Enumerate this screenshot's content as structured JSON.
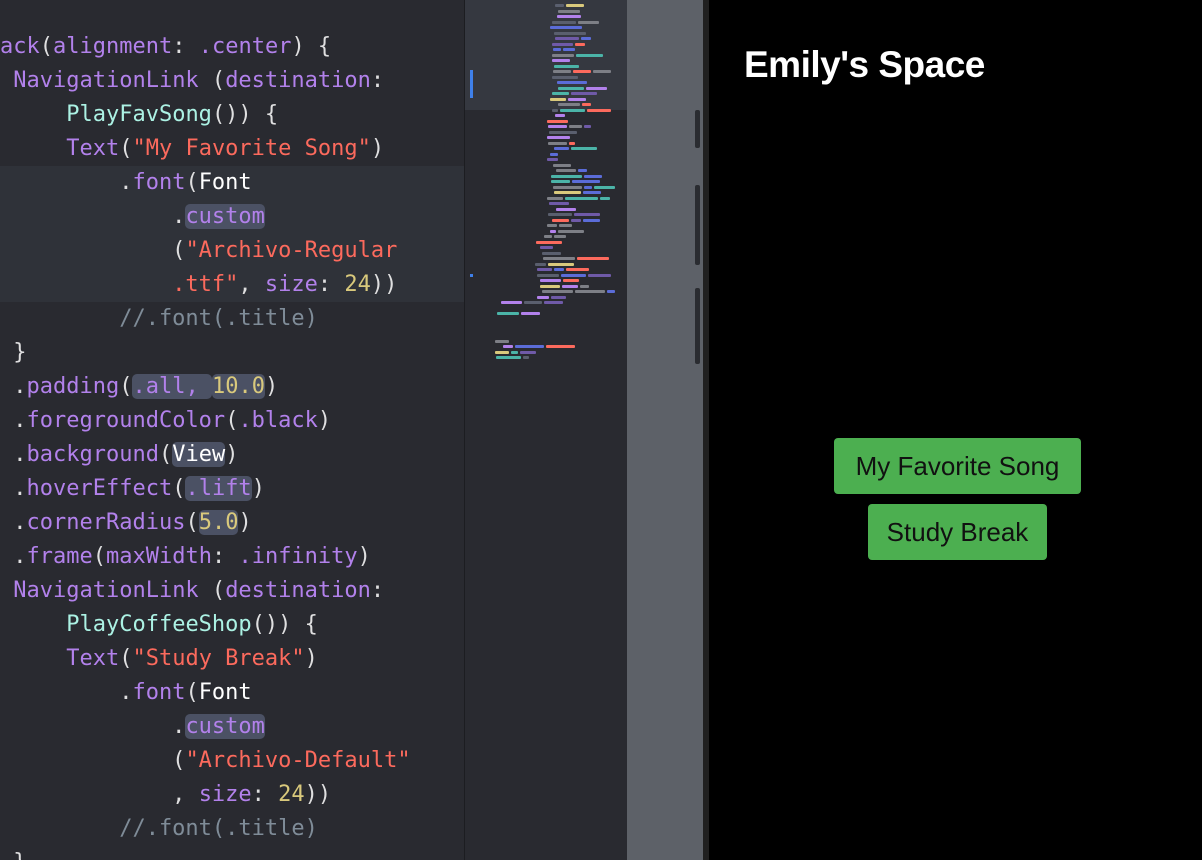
{
  "colors": {
    "editor_bg": "#292a30",
    "keyword": "#fc5fa3",
    "function": "#b281eb",
    "type": "#acf2e4",
    "string": "#fc6a5d",
    "number": "#d9c97c",
    "comment": "#7f8c98",
    "button_green": "#4caf50",
    "preview_bg": "#000000"
  },
  "code_lines": [
    {
      "tokens": [
        {
          "t": "ack",
          "c": "fn"
        },
        {
          "t": "(",
          "c": "pl"
        },
        {
          "t": "alignment",
          "c": "fn"
        },
        {
          "t": ": ",
          "c": "pl"
        },
        {
          "t": ".center",
          "c": "fn"
        },
        {
          "t": ") {",
          "c": "pl"
        }
      ]
    },
    {
      "tokens": [
        {
          "t": " ",
          "c": "pl"
        },
        {
          "t": "NavigationLink",
          "c": "fn"
        },
        {
          "t": " (",
          "c": "pl"
        },
        {
          "t": "destination",
          "c": "fn"
        },
        {
          "t": ":",
          "c": "pl"
        }
      ]
    },
    {
      "tokens": [
        {
          "t": "     ",
          "c": "pl"
        },
        {
          "t": "PlayFavSong",
          "c": "ty"
        },
        {
          "t": "()) {",
          "c": "pl"
        }
      ]
    },
    {
      "tokens": [
        {
          "t": "     ",
          "c": "pl"
        },
        {
          "t": "Text",
          "c": "fn"
        },
        {
          "t": "(",
          "c": "pl"
        },
        {
          "t": "\"My Favorite Song\"",
          "c": "st"
        },
        {
          "t": ")",
          "c": "pl"
        }
      ]
    },
    {
      "hl": true,
      "tokens": [
        {
          "t": "         .",
          "c": "pl"
        },
        {
          "t": "font",
          "c": "fn"
        },
        {
          "t": "(",
          "c": "pl"
        },
        {
          "t": "Font",
          "c": "k"
        }
      ]
    },
    {
      "hl": true,
      "tokens": [
        {
          "t": "             .",
          "c": "pl"
        },
        {
          "t": "custom",
          "c": "fn",
          "pill": true
        }
      ]
    },
    {
      "hl": true,
      "tokens": [
        {
          "t": "             (",
          "c": "pl"
        },
        {
          "t": "\"Archivo-Regular",
          "c": "st"
        }
      ]
    },
    {
      "hl": true,
      "tokens": [
        {
          "t": "             ",
          "c": "pl"
        },
        {
          "t": ".ttf\"",
          "c": "st"
        },
        {
          "t": ", ",
          "c": "pl"
        },
        {
          "t": "size",
          "c": "fn"
        },
        {
          "t": ": ",
          "c": "pl"
        },
        {
          "t": "24",
          "c": "nm"
        },
        {
          "t": "))",
          "c": "pl"
        }
      ]
    },
    {
      "tokens": [
        {
          "t": "         //.font(.title)",
          "c": "cm"
        }
      ]
    },
    {
      "tokens": [
        {
          "t": " }",
          "c": "pl"
        }
      ]
    },
    {
      "tokens": [
        {
          "t": " .",
          "c": "pl"
        },
        {
          "t": "padding",
          "c": "fn"
        },
        {
          "t": "(",
          "c": "pl"
        },
        {
          "t": ".all, ",
          "c": "fn",
          "pill": true
        },
        {
          "t": "10.0",
          "c": "nm",
          "pill": true
        },
        {
          "t": ")",
          "c": "pl"
        }
      ]
    },
    {
      "tokens": [
        {
          "t": " .",
          "c": "pl"
        },
        {
          "t": "foregroundColor",
          "c": "fn"
        },
        {
          "t": "(",
          "c": "pl"
        },
        {
          "t": ".black",
          "c": "fn"
        },
        {
          "t": ")",
          "c": "pl"
        }
      ]
    },
    {
      "tokens": [
        {
          "t": " .",
          "c": "pl"
        },
        {
          "t": "background",
          "c": "fn"
        },
        {
          "t": "(",
          "c": "pl"
        },
        {
          "t": "View",
          "c": "k",
          "pill": true
        },
        {
          "t": ")",
          "c": "pl"
        }
      ]
    },
    {
      "tokens": [
        {
          "t": " .",
          "c": "pl"
        },
        {
          "t": "hoverEffect",
          "c": "fn"
        },
        {
          "t": "(",
          "c": "pl"
        },
        {
          "t": ".lift",
          "c": "fn",
          "pill": true
        },
        {
          "t": ")",
          "c": "pl"
        }
      ]
    },
    {
      "tokens": [
        {
          "t": " .",
          "c": "pl"
        },
        {
          "t": "cornerRadius",
          "c": "fn"
        },
        {
          "t": "(",
          "c": "pl"
        },
        {
          "t": "5.0",
          "c": "nm",
          "pill": true
        },
        {
          "t": ")",
          "c": "pl"
        }
      ]
    },
    {
      "tokens": [
        {
          "t": " .",
          "c": "pl"
        },
        {
          "t": "frame",
          "c": "fn"
        },
        {
          "t": "(",
          "c": "pl"
        },
        {
          "t": "maxWidth",
          "c": "fn"
        },
        {
          "t": ": ",
          "c": "pl"
        },
        {
          "t": ".infinity",
          "c": "fn"
        },
        {
          "t": ")",
          "c": "pl"
        }
      ]
    },
    {
      "tokens": [
        {
          "t": " ",
          "c": "pl"
        },
        {
          "t": "NavigationLink",
          "c": "fn"
        },
        {
          "t": " (",
          "c": "pl"
        },
        {
          "t": "destination",
          "c": "fn"
        },
        {
          "t": ":",
          "c": "pl"
        }
      ]
    },
    {
      "tokens": [
        {
          "t": "     ",
          "c": "pl"
        },
        {
          "t": "PlayCoffeeShop",
          "c": "ty"
        },
        {
          "t": "()) {",
          "c": "pl"
        }
      ]
    },
    {
      "tokens": [
        {
          "t": "     ",
          "c": "pl"
        },
        {
          "t": "Text",
          "c": "fn"
        },
        {
          "t": "(",
          "c": "pl"
        },
        {
          "t": "\"Study Break\"",
          "c": "st"
        },
        {
          "t": ")",
          "c": "pl"
        }
      ]
    },
    {
      "tokens": [
        {
          "t": "         .",
          "c": "pl"
        },
        {
          "t": "font",
          "c": "fn"
        },
        {
          "t": "(",
          "c": "pl"
        },
        {
          "t": "Font",
          "c": "k"
        }
      ]
    },
    {
      "tokens": [
        {
          "t": "             .",
          "c": "pl"
        },
        {
          "t": "custom",
          "c": "fn",
          "pill": true
        }
      ]
    },
    {
      "tokens": [
        {
          "t": "             (",
          "c": "pl"
        },
        {
          "t": "\"Archivo-Default\"",
          "c": "st"
        }
      ]
    },
    {
      "tokens": [
        {
          "t": "             , ",
          "c": "pl"
        },
        {
          "t": "size",
          "c": "fn"
        },
        {
          "t": ": ",
          "c": "pl"
        },
        {
          "t": "24",
          "c": "nm"
        },
        {
          "t": "))",
          "c": "pl"
        }
      ]
    },
    {
      "tokens": [
        {
          "t": "         //.font(.title)",
          "c": "cm"
        }
      ]
    },
    {
      "tokens": [
        {
          "t": " }",
          "c": "pl"
        }
      ]
    }
  ],
  "preview": {
    "title": "Emily's Space",
    "buttons": [
      {
        "label": "My Favorite Song"
      },
      {
        "label": "Study Break"
      }
    ]
  }
}
